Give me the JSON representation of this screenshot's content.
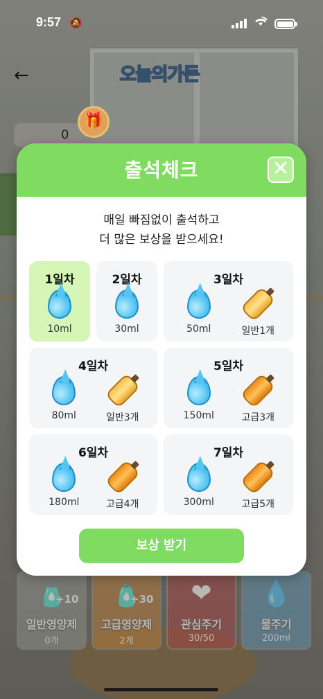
{
  "status_bar": {
    "time": "9:57"
  },
  "header": {
    "logo_text": "오늘의가든",
    "coin_count": "0"
  },
  "bottom_actions": [
    {
      "name": "일반영양제",
      "count": "0개",
      "plus": "+10"
    },
    {
      "name": "고급영양제",
      "count": "2개",
      "plus": "+30"
    },
    {
      "name": "관심주기",
      "count": "30/50"
    },
    {
      "name": "물주기",
      "count": "200ml"
    }
  ],
  "modal": {
    "title": "출석체크",
    "message_line1": "매일 빠짐없이 출석하고",
    "message_line2": "더 많은 보상을 받으세요!",
    "claim_label": "보상 받기",
    "days": [
      {
        "label": "1일차",
        "active": true,
        "rewards": [
          {
            "icon": "water-drop-icon",
            "text": "10ml"
          }
        ]
      },
      {
        "label": "2일차",
        "active": false,
        "rewards": [
          {
            "icon": "water-drop-icon",
            "text": "30ml"
          }
        ]
      },
      {
        "label": "3일차",
        "active": false,
        "rewards": [
          {
            "icon": "water-drop-icon",
            "text": "50ml"
          },
          {
            "icon": "normal-nutrient-bottle-icon",
            "text": "일반1개"
          }
        ]
      },
      {
        "label": "4일차",
        "active": false,
        "rewards": [
          {
            "icon": "water-drop-icon",
            "text": "80ml"
          },
          {
            "icon": "normal-nutrient-bottle-icon",
            "text": "일반3개"
          }
        ]
      },
      {
        "label": "5일차",
        "active": false,
        "rewards": [
          {
            "icon": "water-drop-icon",
            "text": "150ml"
          },
          {
            "icon": "premium-nutrient-bottle-icon",
            "text": "고급3개"
          }
        ]
      },
      {
        "label": "6일차",
        "active": false,
        "rewards": [
          {
            "icon": "water-drop-icon",
            "text": "180ml"
          },
          {
            "icon": "premium-nutrient-bottle-icon",
            "text": "고급4개"
          }
        ]
      },
      {
        "label": "7일차",
        "active": false,
        "rewards": [
          {
            "icon": "water-drop-icon",
            "text": "300ml"
          },
          {
            "icon": "premium-nutrient-bottle-icon",
            "text": "고급5개"
          }
        ]
      }
    ]
  },
  "colors": {
    "accent_green": "#80dc60",
    "active_day_bg": "#d6f6b8"
  }
}
